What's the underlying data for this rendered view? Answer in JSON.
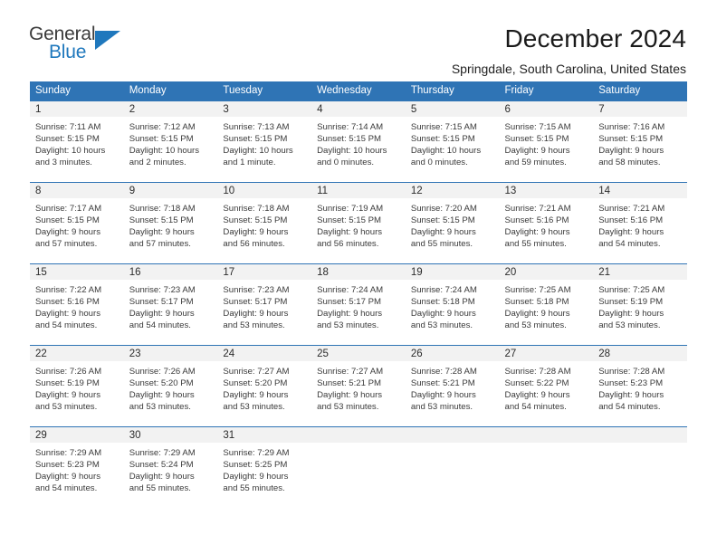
{
  "brand": {
    "name_top": "General",
    "name_bottom": "Blue",
    "accent_color": "#1f78bd",
    "triangle_icon": "triangle-icon"
  },
  "header": {
    "title": "December 2024",
    "subtitle": "Springdale, South Carolina, United States"
  },
  "calendar": {
    "header_color": "#2f74b5",
    "daynum_band_color": "#f2f2f2",
    "weekday_headers": [
      "Sunday",
      "Monday",
      "Tuesday",
      "Wednesday",
      "Thursday",
      "Friday",
      "Saturday"
    ],
    "labels": {
      "sunrise": "Sunrise:",
      "sunset": "Sunset:",
      "daylight": "Daylight:"
    },
    "weeks": [
      [
        {
          "day": "1",
          "sunrise": "Sunrise: 7:11 AM",
          "sunset": "Sunset: 5:15 PM",
          "daylight_1": "Daylight: 10 hours",
          "daylight_2": "and 3 minutes."
        },
        {
          "day": "2",
          "sunrise": "Sunrise: 7:12 AM",
          "sunset": "Sunset: 5:15 PM",
          "daylight_1": "Daylight: 10 hours",
          "daylight_2": "and 2 minutes."
        },
        {
          "day": "3",
          "sunrise": "Sunrise: 7:13 AM",
          "sunset": "Sunset: 5:15 PM",
          "daylight_1": "Daylight: 10 hours",
          "daylight_2": "and 1 minute."
        },
        {
          "day": "4",
          "sunrise": "Sunrise: 7:14 AM",
          "sunset": "Sunset: 5:15 PM",
          "daylight_1": "Daylight: 10 hours",
          "daylight_2": "and 0 minutes."
        },
        {
          "day": "5",
          "sunrise": "Sunrise: 7:15 AM",
          "sunset": "Sunset: 5:15 PM",
          "daylight_1": "Daylight: 10 hours",
          "daylight_2": "and 0 minutes."
        },
        {
          "day": "6",
          "sunrise": "Sunrise: 7:15 AM",
          "sunset": "Sunset: 5:15 PM",
          "daylight_1": "Daylight: 9 hours",
          "daylight_2": "and 59 minutes."
        },
        {
          "day": "7",
          "sunrise": "Sunrise: 7:16 AM",
          "sunset": "Sunset: 5:15 PM",
          "daylight_1": "Daylight: 9 hours",
          "daylight_2": "and 58 minutes."
        }
      ],
      [
        {
          "day": "8",
          "sunrise": "Sunrise: 7:17 AM",
          "sunset": "Sunset: 5:15 PM",
          "daylight_1": "Daylight: 9 hours",
          "daylight_2": "and 57 minutes."
        },
        {
          "day": "9",
          "sunrise": "Sunrise: 7:18 AM",
          "sunset": "Sunset: 5:15 PM",
          "daylight_1": "Daylight: 9 hours",
          "daylight_2": "and 57 minutes."
        },
        {
          "day": "10",
          "sunrise": "Sunrise: 7:18 AM",
          "sunset": "Sunset: 5:15 PM",
          "daylight_1": "Daylight: 9 hours",
          "daylight_2": "and 56 minutes."
        },
        {
          "day": "11",
          "sunrise": "Sunrise: 7:19 AM",
          "sunset": "Sunset: 5:15 PM",
          "daylight_1": "Daylight: 9 hours",
          "daylight_2": "and 56 minutes."
        },
        {
          "day": "12",
          "sunrise": "Sunrise: 7:20 AM",
          "sunset": "Sunset: 5:15 PM",
          "daylight_1": "Daylight: 9 hours",
          "daylight_2": "and 55 minutes."
        },
        {
          "day": "13",
          "sunrise": "Sunrise: 7:21 AM",
          "sunset": "Sunset: 5:16 PM",
          "daylight_1": "Daylight: 9 hours",
          "daylight_2": "and 55 minutes."
        },
        {
          "day": "14",
          "sunrise": "Sunrise: 7:21 AM",
          "sunset": "Sunset: 5:16 PM",
          "daylight_1": "Daylight: 9 hours",
          "daylight_2": "and 54 minutes."
        }
      ],
      [
        {
          "day": "15",
          "sunrise": "Sunrise: 7:22 AM",
          "sunset": "Sunset: 5:16 PM",
          "daylight_1": "Daylight: 9 hours",
          "daylight_2": "and 54 minutes."
        },
        {
          "day": "16",
          "sunrise": "Sunrise: 7:23 AM",
          "sunset": "Sunset: 5:17 PM",
          "daylight_1": "Daylight: 9 hours",
          "daylight_2": "and 54 minutes."
        },
        {
          "day": "17",
          "sunrise": "Sunrise: 7:23 AM",
          "sunset": "Sunset: 5:17 PM",
          "daylight_1": "Daylight: 9 hours",
          "daylight_2": "and 53 minutes."
        },
        {
          "day": "18",
          "sunrise": "Sunrise: 7:24 AM",
          "sunset": "Sunset: 5:17 PM",
          "daylight_1": "Daylight: 9 hours",
          "daylight_2": "and 53 minutes."
        },
        {
          "day": "19",
          "sunrise": "Sunrise: 7:24 AM",
          "sunset": "Sunset: 5:18 PM",
          "daylight_1": "Daylight: 9 hours",
          "daylight_2": "and 53 minutes."
        },
        {
          "day": "20",
          "sunrise": "Sunrise: 7:25 AM",
          "sunset": "Sunset: 5:18 PM",
          "daylight_1": "Daylight: 9 hours",
          "daylight_2": "and 53 minutes."
        },
        {
          "day": "21",
          "sunrise": "Sunrise: 7:25 AM",
          "sunset": "Sunset: 5:19 PM",
          "daylight_1": "Daylight: 9 hours",
          "daylight_2": "and 53 minutes."
        }
      ],
      [
        {
          "day": "22",
          "sunrise": "Sunrise: 7:26 AM",
          "sunset": "Sunset: 5:19 PM",
          "daylight_1": "Daylight: 9 hours",
          "daylight_2": "and 53 minutes."
        },
        {
          "day": "23",
          "sunrise": "Sunrise: 7:26 AM",
          "sunset": "Sunset: 5:20 PM",
          "daylight_1": "Daylight: 9 hours",
          "daylight_2": "and 53 minutes."
        },
        {
          "day": "24",
          "sunrise": "Sunrise: 7:27 AM",
          "sunset": "Sunset: 5:20 PM",
          "daylight_1": "Daylight: 9 hours",
          "daylight_2": "and 53 minutes."
        },
        {
          "day": "25",
          "sunrise": "Sunrise: 7:27 AM",
          "sunset": "Sunset: 5:21 PM",
          "daylight_1": "Daylight: 9 hours",
          "daylight_2": "and 53 minutes."
        },
        {
          "day": "26",
          "sunrise": "Sunrise: 7:28 AM",
          "sunset": "Sunset: 5:21 PM",
          "daylight_1": "Daylight: 9 hours",
          "daylight_2": "and 53 minutes."
        },
        {
          "day": "27",
          "sunrise": "Sunrise: 7:28 AM",
          "sunset": "Sunset: 5:22 PM",
          "daylight_1": "Daylight: 9 hours",
          "daylight_2": "and 54 minutes."
        },
        {
          "day": "28",
          "sunrise": "Sunrise: 7:28 AM",
          "sunset": "Sunset: 5:23 PM",
          "daylight_1": "Daylight: 9 hours",
          "daylight_2": "and 54 minutes."
        }
      ],
      [
        {
          "day": "29",
          "sunrise": "Sunrise: 7:29 AM",
          "sunset": "Sunset: 5:23 PM",
          "daylight_1": "Daylight: 9 hours",
          "daylight_2": "and 54 minutes."
        },
        {
          "day": "30",
          "sunrise": "Sunrise: 7:29 AM",
          "sunset": "Sunset: 5:24 PM",
          "daylight_1": "Daylight: 9 hours",
          "daylight_2": "and 55 minutes."
        },
        {
          "day": "31",
          "sunrise": "Sunrise: 7:29 AM",
          "sunset": "Sunset: 5:25 PM",
          "daylight_1": "Daylight: 9 hours",
          "daylight_2": "and 55 minutes."
        },
        {
          "day": "",
          "sunrise": "",
          "sunset": "",
          "daylight_1": "",
          "daylight_2": ""
        },
        {
          "day": "",
          "sunrise": "",
          "sunset": "",
          "daylight_1": "",
          "daylight_2": ""
        },
        {
          "day": "",
          "sunrise": "",
          "sunset": "",
          "daylight_1": "",
          "daylight_2": ""
        },
        {
          "day": "",
          "sunrise": "",
          "sunset": "",
          "daylight_1": "",
          "daylight_2": ""
        }
      ]
    ]
  }
}
